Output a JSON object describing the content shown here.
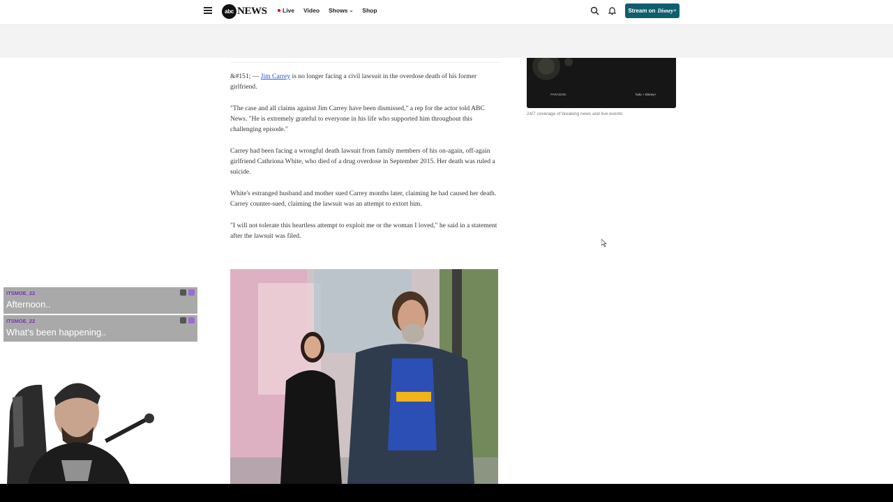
{
  "nav": {
    "logo_abc": "abc",
    "logo_news": "NEWS",
    "links": [
      "Live",
      "Video",
      "Shows",
      "Shop"
    ],
    "stream_label": "Stream on",
    "stream_brand": "Disney+"
  },
  "article": {
    "p1_prefix": "&#151; — ",
    "p1_link": "Jim Carrey",
    "p1_rest": " is no longer facing a civil lawsuit in the overdose death of his former girlfriend.",
    "p2": "\"The case and all claims against Jim Carrey have been dismissed,\" a rep for the actor told ABC News. \"He is extremely grateful to everyone in his life who supported him throughout this challenging episode.\"",
    "p3": "Carrey had been facing a wrongful death lawsuit from family members of his on-again, off-again girlfriend Cathriona White, who died of a drug overdose in September 2015. Her death was ruled a suicide.",
    "p4": "White's estranged husband and mother sued Carrey months later, claiming he had caused her death. Carrey counter-sued, claiming the lawsuit was an attempt to extort him.",
    "p5": "\"I will not tolerate this heartless attempt to exploit me or the woman I loved,\" he said in a statement after the lawsuit was filed."
  },
  "sidebar": {
    "video_label_left": "PARADISE",
    "video_label_right": "hulu + Disney+",
    "caption": "24/7 coverage of breaking news and live events"
  },
  "chat": [
    {
      "user": "ITSMOE_22",
      "text": "Afternoon.."
    },
    {
      "user": "ITSMOE_22",
      "text": "What's been happening.."
    }
  ]
}
